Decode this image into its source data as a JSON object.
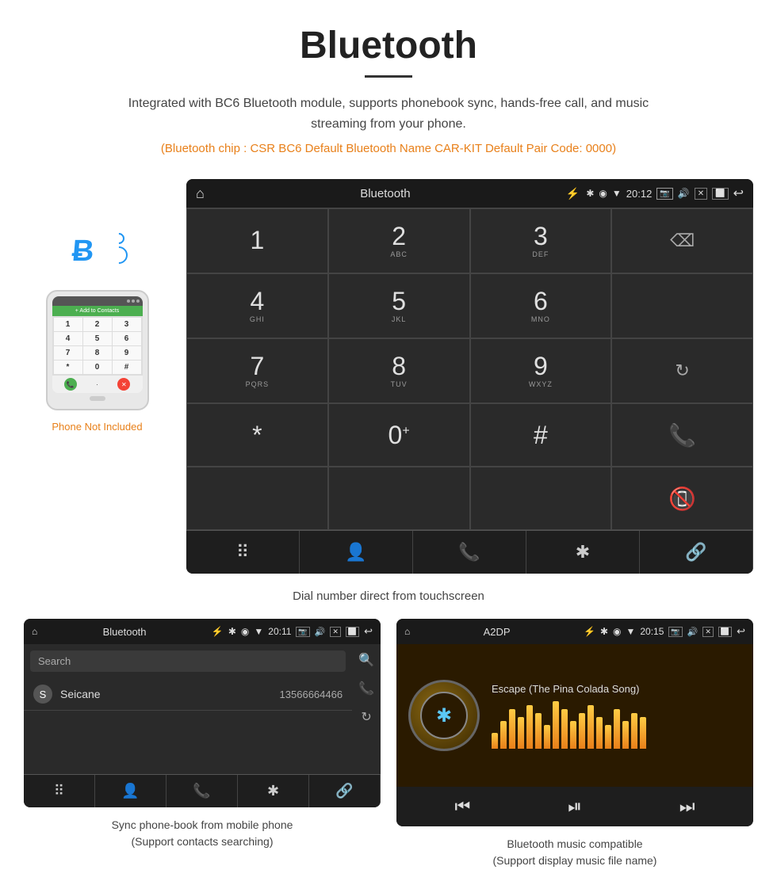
{
  "page": {
    "title": "Bluetooth",
    "underline": true,
    "description": "Integrated with BC6 Bluetooth module, supports phonebook sync, hands-free call, and music streaming from your phone.",
    "specs": "(Bluetooth chip : CSR BC6    Default Bluetooth Name CAR-KIT    Default Pair Code: 0000)",
    "phone_not_included": "Phone Not Included",
    "dial_caption": "Dial number direct from touchscreen"
  },
  "status_bar": {
    "home_icon": "⌂",
    "title": "Bluetooth",
    "usb_icon": "⚡",
    "bt_icon": "✱",
    "location_icon": "◉",
    "signal_icon": "▼",
    "time": "20:12",
    "camera_icon": "📷",
    "volume_icon": "🔊",
    "close_icon": "✕",
    "window_icon": "⬜",
    "back_icon": "↩"
  },
  "dial_keys": [
    {
      "num": "1",
      "sub": ""
    },
    {
      "num": "2",
      "sub": "ABC"
    },
    {
      "num": "3",
      "sub": "DEF"
    },
    {
      "num": "",
      "sub": "",
      "action": "backspace"
    },
    {
      "num": "4",
      "sub": "GHI"
    },
    {
      "num": "5",
      "sub": "JKL"
    },
    {
      "num": "6",
      "sub": "MNO"
    },
    {
      "num": "",
      "sub": "",
      "action": "empty"
    },
    {
      "num": "7",
      "sub": "PQRS"
    },
    {
      "num": "8",
      "sub": "TUV"
    },
    {
      "num": "9",
      "sub": "WXYZ"
    },
    {
      "num": "",
      "sub": "",
      "action": "refresh"
    },
    {
      "num": "*",
      "sub": ""
    },
    {
      "num": "0",
      "sub": "+"
    },
    {
      "num": "#",
      "sub": ""
    },
    {
      "num": "",
      "sub": "",
      "action": "call-green"
    },
    {
      "num": "",
      "sub": "",
      "action": "empty"
    },
    {
      "num": "",
      "sub": "",
      "action": "empty"
    },
    {
      "num": "",
      "sub": "",
      "action": "empty"
    },
    {
      "num": "",
      "sub": "",
      "action": "call-red"
    }
  ],
  "action_bar": [
    {
      "icon": "⠿",
      "label": "dialpad"
    },
    {
      "icon": "👤",
      "label": "contacts"
    },
    {
      "icon": "📞",
      "label": "call"
    },
    {
      "icon": "✱",
      "label": "bluetooth"
    },
    {
      "icon": "🔗",
      "label": "link"
    }
  ],
  "phonebook": {
    "status_bar_title": "Bluetooth",
    "time": "20:11",
    "search_placeholder": "Search",
    "contact": {
      "initial": "S",
      "name": "Seicane",
      "number": "13566664466"
    },
    "caption": "Sync phone-book from mobile phone\n(Support contacts searching)"
  },
  "music": {
    "status_bar_title": "A2DP",
    "time": "20:15",
    "song_name": "Escape (The Pina Colada Song)",
    "eq_bars": [
      20,
      35,
      50,
      40,
      55,
      45,
      30,
      60,
      50,
      35,
      45,
      55,
      40,
      30,
      50,
      35,
      45,
      40
    ],
    "caption": "Bluetooth music compatible\n(Support display music file name)"
  },
  "phone_keys": [
    "1",
    "2",
    "3",
    "4",
    "5",
    "6",
    "7",
    "8",
    "9",
    "*",
    "0",
    "#"
  ]
}
